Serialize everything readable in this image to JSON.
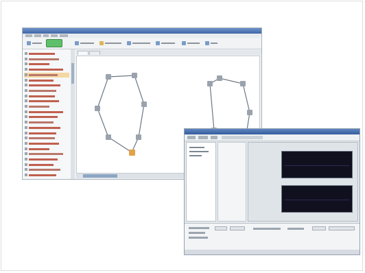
{
  "screenshot": {
    "description_visible_text": "",
    "back_window": {
      "toolbar_items": 8,
      "active_tool_color": "#5fbf6a",
      "sidebar_rows": 24,
      "selected_sidebar_row": 4,
      "graph": {
        "left_ring_nodes": 7,
        "right_ring_nodes": 6,
        "node_color": "#9aa3ad",
        "highlight_node_color": "#e3a24a",
        "edge_color": "#6b7684"
      }
    },
    "front_window": {
      "scope_panels": 2,
      "scope_background": "#10101f",
      "accent_title_color": "#335c9c"
    }
  }
}
